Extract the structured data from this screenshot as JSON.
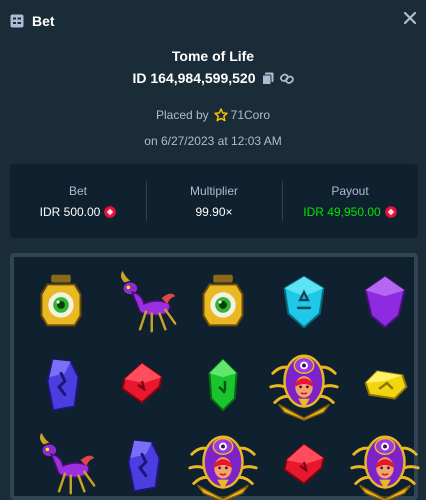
{
  "header": {
    "title": "Bet",
    "icon": "bet-slip-icon",
    "close_icon": "close-icon"
  },
  "game": {
    "name": "Tome of Life"
  },
  "bet_id": {
    "label": "ID 164,984,599,520",
    "copy_icon": "copy-icon",
    "link_icon": "link-icon"
  },
  "placed_by": {
    "prefix": "Placed by",
    "user": "71Coro",
    "icon": "star-icon"
  },
  "date": "on 6/27/2023 at 12:03 AM",
  "stats": {
    "bet": {
      "label": "Bet",
      "value": "IDR 500.00"
    },
    "multiplier": {
      "label": "Multiplier",
      "value": "99.90×"
    },
    "payout": {
      "label": "Payout",
      "value": "IDR 49,950.00"
    },
    "currency_icon": "idr-coin-icon"
  },
  "colors": {
    "background": "#1a2c38",
    "panel": "#0f212e",
    "border": "#2f4553",
    "text_muted": "#b1bad3",
    "win_green": "#00e701",
    "coin_red": "#e9113c"
  },
  "board": {
    "rows": [
      [
        "eye-lantern",
        "purple-creature",
        "eye-lantern",
        "cyan-gem",
        "purple-gem"
      ],
      [
        "blue-rune-gem",
        "red-gem",
        "green-gem",
        "spider-queen",
        "yellow-gem"
      ],
      [
        "purple-creature",
        "blue-rune-gem",
        "spider-queen",
        "red-gem",
        "spider-queen"
      ]
    ]
  }
}
